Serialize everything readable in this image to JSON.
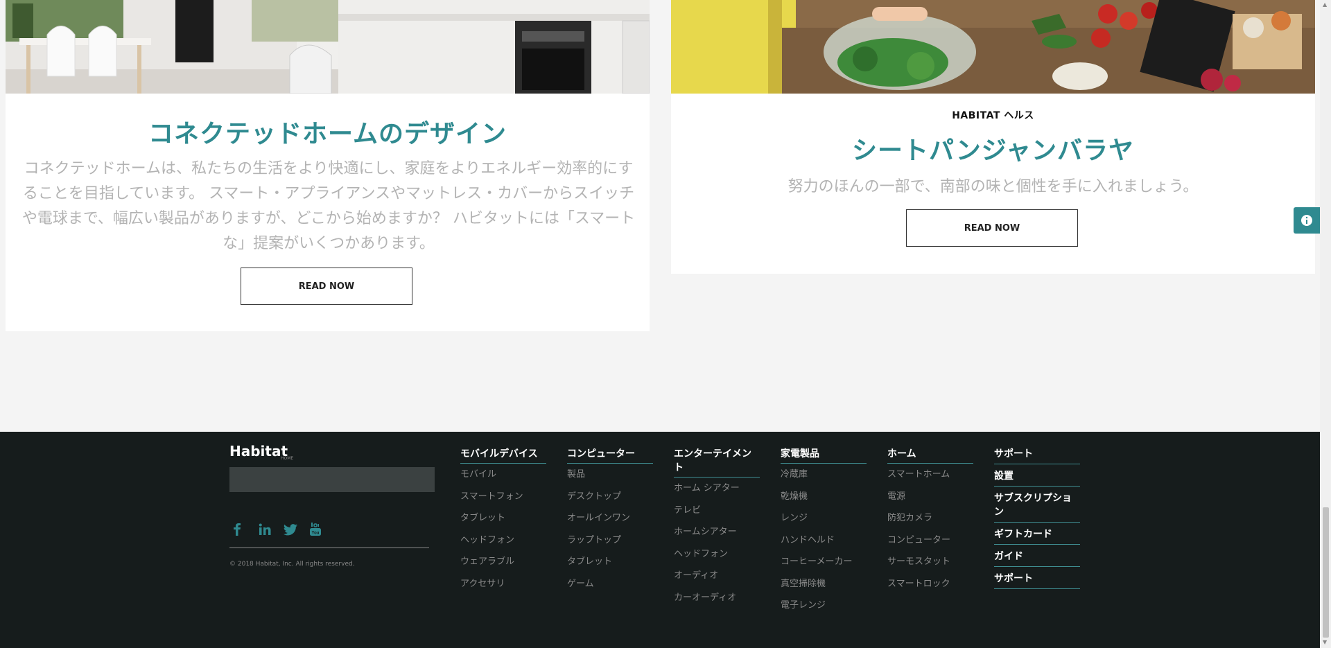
{
  "articles": [
    {
      "title": "コネクテッドホームのデザイン",
      "body": "コネクテッドホームは、私たちの生活をより快適にし、家庭をよりエネルギー効率的にすることを目指しています。 スマート・アプライアンスやマットレス・カバーからスイッチや電球まで、幅広い製品がありますが、どこから始めますか？ ハビタットには「スマートな」提案がいくつかあります。",
      "button": "READ NOW"
    },
    {
      "kicker": "HABITAT ヘルス",
      "title": "シートパンジャンバラヤ",
      "body": "努力のほんの一部で、南部の味と個性を手に入れましょう。",
      "button": "READ NOW"
    }
  ],
  "info_icon": "info-icon",
  "footer": {
    "logo": "Habitat",
    "logo_sub": "HOME",
    "newsletter_placeholder": "",
    "social_icons": [
      "facebook-icon",
      "linkedin-icon",
      "twitter-icon",
      "youtube-icon"
    ],
    "copyright": "© 2018 Habitat, Inc. All rights reserved.",
    "columns": [
      {
        "heading": "モバイルデバイス",
        "items": [
          "モバイル",
          "スマートフォン",
          "タブレット",
          "ヘッドフォン",
          "ウェアラブル",
          "アクセサリ"
        ]
      },
      {
        "heading": "コンピューター",
        "items": [
          "製品",
          "デスクトップ",
          "オールインワン",
          "ラップトップ",
          "タブレット",
          "ゲーム"
        ]
      },
      {
        "heading": "エンターテイメント",
        "items": [
          "ホーム シアター",
          "テレビ",
          "ホームシアター",
          "ヘッドフォン",
          "オーディオ",
          "カーオーディオ"
        ]
      },
      {
        "heading": "家電製品",
        "items": [
          "冷蔵庫",
          "乾燥機",
          "レンジ",
          "ハンドヘルド",
          "コーヒーメーカー",
          "真空掃除機",
          "電子レンジ"
        ]
      },
      {
        "heading": "ホーム",
        "items": [
          "スマートホーム",
          "電源",
          "防犯カメラ",
          "コンピューター",
          "サーモスタット",
          "スマートロック"
        ]
      }
    ],
    "support": [
      "サポート",
      "設置",
      "サブスクリプション",
      "ギフトカード",
      "ガイド",
      "サポート"
    ]
  },
  "colors": {
    "accent": "#2f8a90",
    "footer_bg": "#161c1c",
    "page_bg": "#f4f4f4"
  }
}
